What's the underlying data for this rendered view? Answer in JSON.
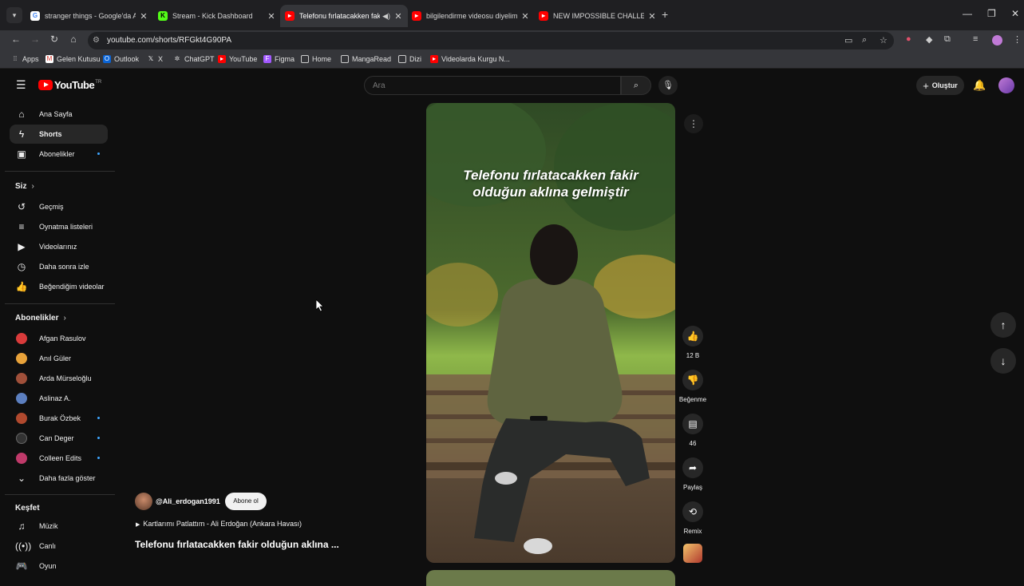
{
  "browser": {
    "tabs": [
      {
        "title": "stranger things - Google'da Ara",
        "favicon": "google-icon",
        "color": "#4285f4"
      },
      {
        "title": "Stream - Kick Dashboard",
        "favicon": "kick-icon",
        "color": "#53fc18"
      },
      {
        "title": "Telefonu fırlatacakken fakir",
        "favicon": "youtube-icon",
        "color": "#ff0000",
        "active": true
      },
      {
        "title": "bilgilendirme videosu diyelim :)",
        "favicon": "youtube-icon",
        "color": "#ff0000"
      },
      {
        "title": "NEW IMPOSSIBLE CHALLENGE",
        "favicon": "youtube-icon",
        "color": "#ff0000"
      }
    ],
    "url": "youtube.com/shorts/RFGkt4G90PA",
    "bookmarks": [
      "Apps",
      "Gelen Kutusu",
      "Outlook",
      "X",
      "ChatGPT",
      "YouTube",
      "Figma",
      "Home",
      "MangaRead",
      "Dizi",
      "Videolarda Kurgu N..."
    ]
  },
  "header": {
    "logo_text": "YouTube",
    "country_code": "TR",
    "search_placeholder": "Ara",
    "create_label": "Oluştur"
  },
  "sidebar": {
    "main": [
      {
        "label": "Ana Sayfa",
        "icon": "home-icon"
      },
      {
        "label": "Shorts",
        "icon": "shorts-icon",
        "active": true
      },
      {
        "label": "Abonelikler",
        "icon": "subscriptions-icon"
      }
    ],
    "you_heading": "Siz",
    "you": [
      {
        "label": "Geçmiş",
        "icon": "history-icon"
      },
      {
        "label": "Oynatma listeleri",
        "icon": "playlists-icon"
      },
      {
        "label": "Videolarınız",
        "icon": "your-videos-icon"
      },
      {
        "label": "Daha sonra izle",
        "icon": "watch-later-icon"
      },
      {
        "label": "Beğendiğim videolar",
        "icon": "liked-icon"
      }
    ],
    "subs_heading": "Abonelikler",
    "subs": [
      {
        "label": "Afgan Rasulov",
        "color": "#d93b3b"
      },
      {
        "label": "Anıl Güler",
        "color": "#e8a23a"
      },
      {
        "label": "Arda Mürseloğlu",
        "color": "#a0503a"
      },
      {
        "label": "Aslinaz A.",
        "color": "#5c7fbf"
      },
      {
        "label": "Burak Özbek",
        "color": "#b0492e"
      },
      {
        "label": "Can Deger",
        "color": "#333333"
      },
      {
        "label": "Colleen Edits",
        "color": "#c03a6a"
      }
    ],
    "show_more": "Daha fazla göster",
    "explore_heading": "Keşfet",
    "explore": [
      {
        "label": "Müzik",
        "icon": "music-icon"
      },
      {
        "label": "Canlı",
        "icon": "live-icon"
      },
      {
        "label": "Oyun",
        "icon": "gaming-icon"
      }
    ]
  },
  "short": {
    "overlay_line1": "Telefonu fırlatacakken fakir",
    "overlay_line2": "olduğun aklına gelmiştir",
    "channel": "@Ali_erdogan1991",
    "subscribe_label": "Abone ol",
    "music": "Kartlarımı Patlattım - Ali Erdoğan (Ankara Havası)",
    "title": "Telefonu fırlatacakken fakir olduğun aklına ...",
    "likes": "12 B",
    "dislike_label": "Beğenme",
    "comments": "46",
    "share_label": "Paylaş",
    "remix_label": "Remix"
  }
}
